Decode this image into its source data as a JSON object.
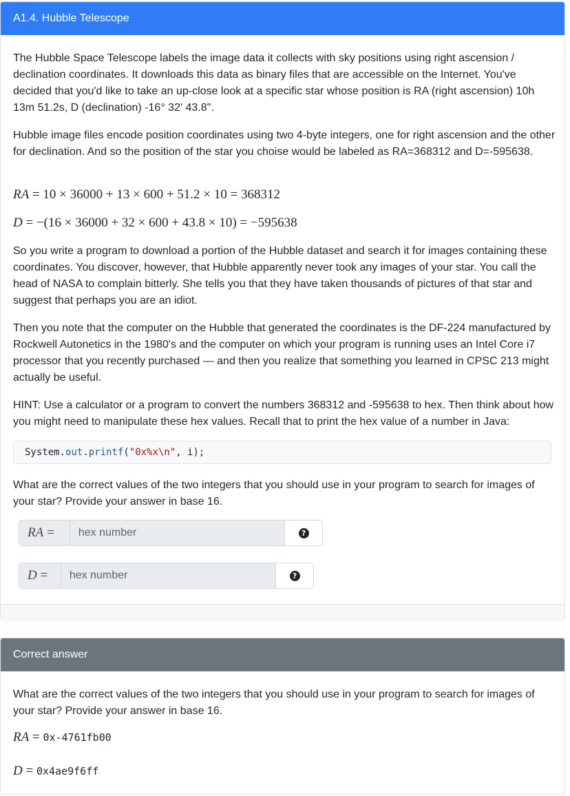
{
  "question_card": {
    "title": "A1.4. Hubble Telescope",
    "paragraph1": "The Hubble Space Telescope labels the image data it collects with sky positions using right ascension / declination coordinates. It downloads this data as binary files that are accessible on the Internet. You've decided that you'd like to take an up-close look at a specific star whose position is RA (right ascension) 10h 13m 51.2s, D (declination) -16° 32' 43.8''.",
    "paragraph2": "Hubble image files encode position coordinates using two 4-byte integers, one for right ascension and the other for declination. And so the position of the star you choise would be labeled as RA=368312 and D=-595638.",
    "eq_ra_var": "RA",
    "eq_ra_rhs": " = 10 × 36000 + 13 × 600 + 51.2 × 10 = 368312",
    "eq_d_var": "D",
    "eq_d_rhs": " = −(16 × 36000 + 32 × 600 + 43.8 × 10) = −595638",
    "paragraph3": "So you write a program to download a portion of the Hubble dataset and search it for images containing these coordinates. You discover, however, that Hubble apparently never took any images of your star. You call the head of NASA to complain bitterly. She tells you that they have taken thousands of pictures of that star and suggest that perhaps you are an idiot.",
    "paragraph4": "Then you note that the computer on the Hubble that generated the coordinates is the DF-224 manufactured by Rockwell Autonetics in the 1980's and the computer on which your program is running uses an Intel Core i7 processor that you recently purchased — and then you realize that something you learned in CPSC 213 might actually be useful.",
    "paragraph5": "HINT: Use a calculator or a program to convert the numbers 368312 and -595638 to hex. Then think about how you might need to manipulate these hex values. Recall that to print the hex value of a number in Java:",
    "code": {
      "part1": "System.",
      "part2": "out",
      "part3": ".",
      "part4": "printf",
      "part5": "(",
      "part6": "\"0x%x\\n\"",
      "part7": ", i);"
    },
    "prompt": "What are the correct values of the two integers that you should use in your program to search for images of your star? Provide your answer in base 16.",
    "input_ra": {
      "label_var": "RA",
      "label_eq": " =",
      "placeholder": "hex number",
      "help_icon": "question-circle-icon"
    },
    "input_d": {
      "label_var": "D",
      "label_eq": " =",
      "placeholder": "hex number",
      "help_icon": "question-circle-icon"
    },
    "help_glyph": "?"
  },
  "answer_card": {
    "title": "Correct answer",
    "prompt": "What are the correct values of the two integers that you should use in your program to search for images of your star? Provide your answer in base 16.",
    "ra_var": "RA",
    "ra_eq": " = ",
    "ra_value": "0x-4761fb00",
    "d_var": "D",
    "d_eq": " = ",
    "d_value": "0x4ae9f6ff"
  },
  "colors": {
    "question_header": "#2f7cf5",
    "answer_header": "#6d757c"
  }
}
